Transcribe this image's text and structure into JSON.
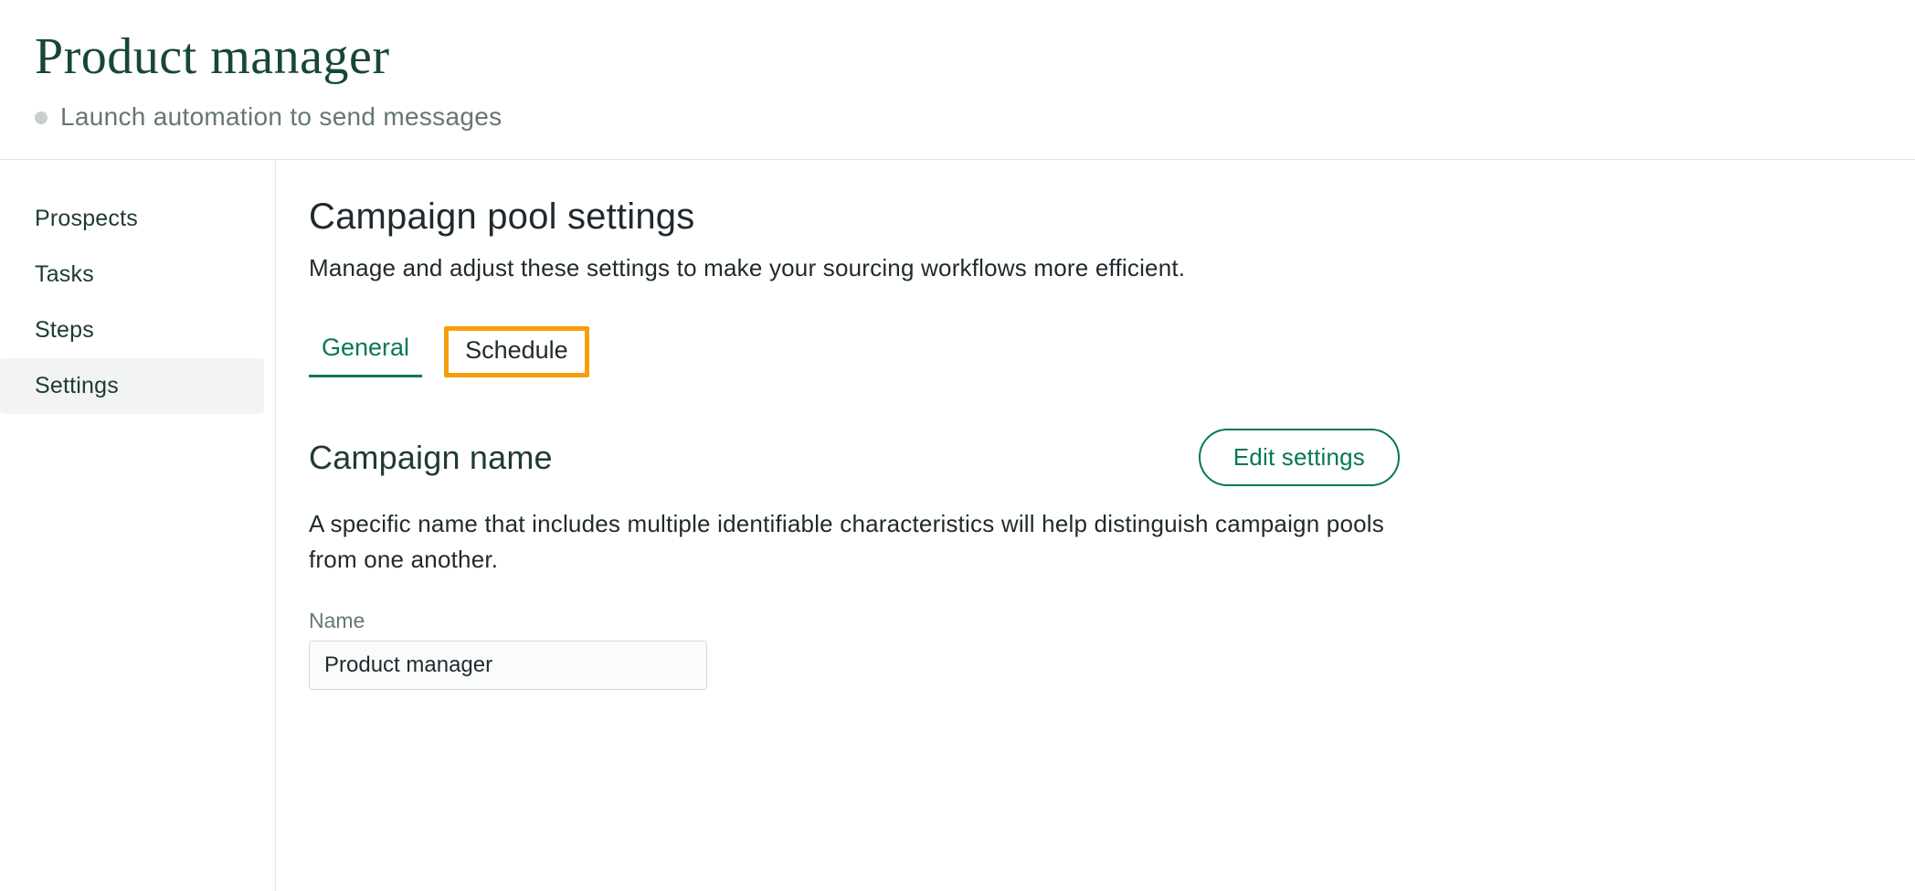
{
  "header": {
    "title": "Product manager",
    "subtitle": "Launch automation to send messages"
  },
  "sidebar": {
    "items": [
      {
        "label": "Prospects"
      },
      {
        "label": "Tasks"
      },
      {
        "label": "Steps"
      },
      {
        "label": "Settings"
      }
    ]
  },
  "settings": {
    "title": "Campaign pool settings",
    "description": "Manage and adjust these settings to make your sourcing workflows more efficient.",
    "tabs": [
      {
        "label": "General"
      },
      {
        "label": "Schedule"
      }
    ],
    "campaign_name": {
      "title": "Campaign name",
      "edit_label": "Edit settings",
      "description": "A specific name that includes multiple identifiable characteristics will help distinguish campaign pools from one another.",
      "field_label": "Name",
      "value": "Product manager"
    }
  }
}
